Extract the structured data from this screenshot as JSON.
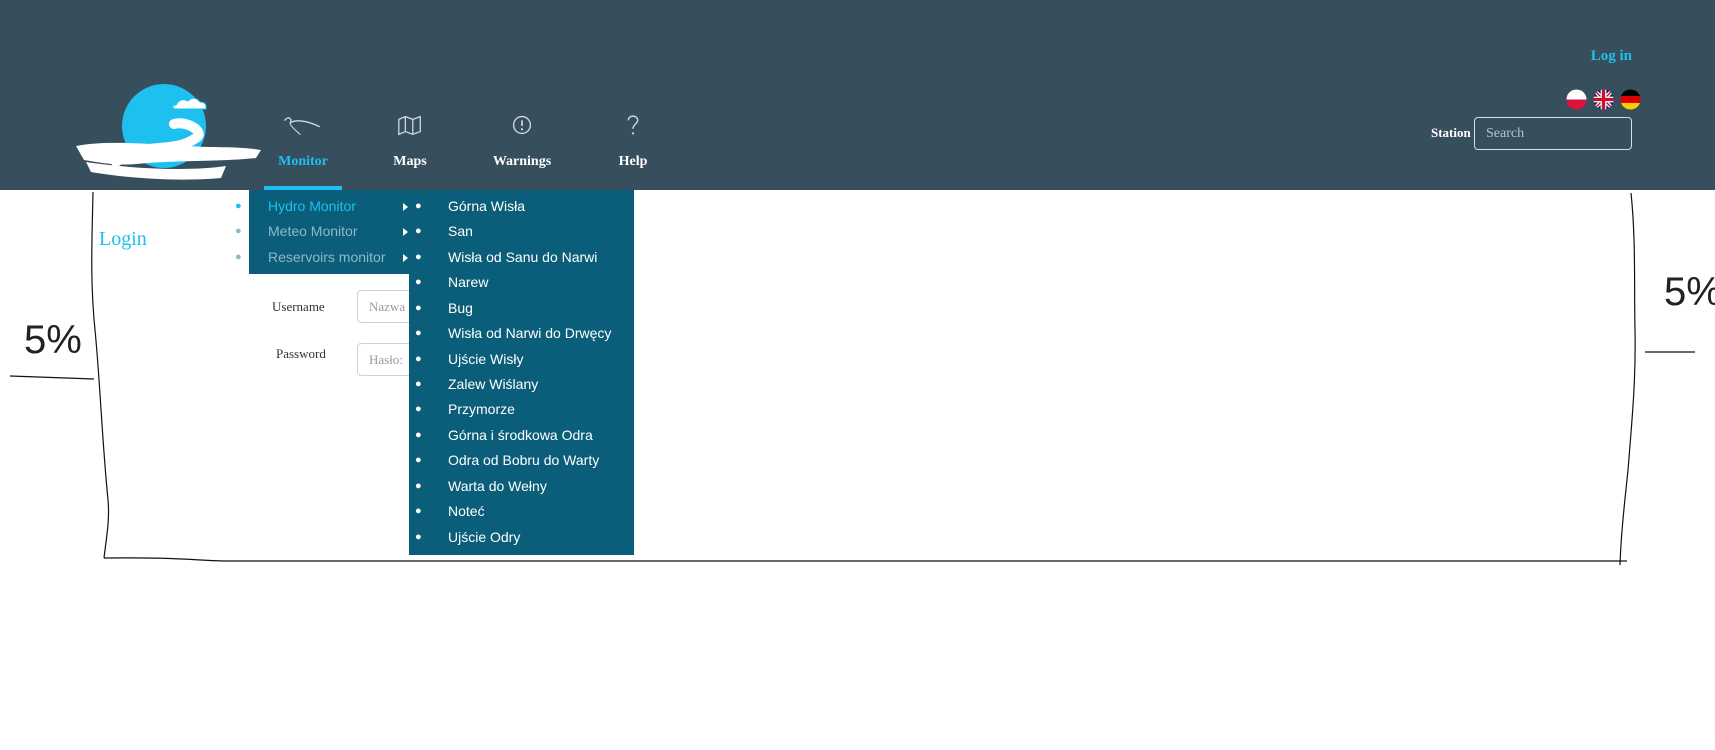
{
  "header": {
    "login_link": "Log in",
    "nav": [
      {
        "label": "Monitor",
        "icon": "river-icon",
        "active": true
      },
      {
        "label": "Maps",
        "icon": "map-icon",
        "active": false
      },
      {
        "label": "Warnings",
        "icon": "warning-icon",
        "active": false
      },
      {
        "label": "Help",
        "icon": "help-icon",
        "active": false
      }
    ],
    "languages": [
      "pl",
      "en",
      "de"
    ],
    "station_label": "Station",
    "search_placeholder": "Search",
    "colors": {
      "bar": "#374e5d",
      "accent": "#1ec0f0",
      "menu": "#0a5e7a"
    }
  },
  "login": {
    "title": "Login",
    "username_label": "Username",
    "username_placeholder": "Nazwa",
    "password_label": "Password",
    "password_placeholder": "Hasło:"
  },
  "monitor_menu": {
    "items": [
      {
        "label": "Hydro Monitor",
        "active": true
      },
      {
        "label": "Meteo Monitor",
        "active": false
      },
      {
        "label": "Reservoirs monitor",
        "active": false
      }
    ]
  },
  "hydro_submenu": {
    "items": [
      "Górna Wisła",
      "San",
      "Wisła od Sanu do Narwi",
      "Narew",
      "Bug",
      "Wisła od Narwi do Drwęcy",
      "Ujście Wisły",
      "Zalew Wiślany",
      "Przymorze",
      "Górna i środkowa Odra",
      "Odra od Bobru do Warty",
      "Warta do Wełny",
      "Noteć",
      "Ujście Odry"
    ]
  },
  "annotations": {
    "left_margin": "5%",
    "right_margin": "5%"
  }
}
